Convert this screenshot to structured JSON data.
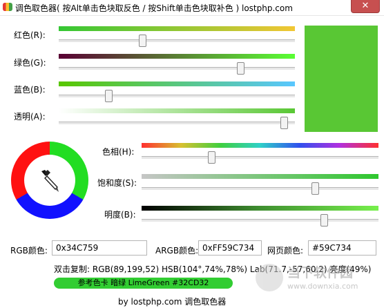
{
  "window": {
    "title": "调色取色器( 按Alt单击色块取反色 / 按Shift单击色块取补色 ) lostphp.com",
    "close_glyph": "✕"
  },
  "rgb_sliders": [
    {
      "label": "红色(R):",
      "value": 89,
      "max": 255,
      "gradient": [
        "#34c734",
        "#f2c734"
      ]
    },
    {
      "label": "绿色(G):",
      "value": 199,
      "max": 255,
      "gradient": [
        "#590034",
        "#59ff34"
      ]
    },
    {
      "label": "蓝色(B):",
      "value": 52,
      "max": 255,
      "gradient": [
        "#59c700",
        "#59c7ff"
      ]
    },
    {
      "label": "透明(A):",
      "value": 247,
      "max": 255,
      "gradient": [
        "#ffffff",
        "#59c734"
      ]
    }
  ],
  "hsb_sliders": [
    {
      "label": "色相(H):",
      "value": 104,
      "max": 360
    },
    {
      "label": "饱和度(S):",
      "value": 74,
      "max": 100
    },
    {
      "label": "明度(B):",
      "value": 78,
      "max": 100
    }
  ],
  "color_swatch": "#59c734",
  "wheel_colors": [
    "#ff1111",
    "#22dd22",
    "#1111ff"
  ],
  "dropper_icon": "eyedropper-icon",
  "fields": {
    "rgb_label": "RGB颜色:",
    "rgb_value": "0x34C759",
    "argb_label": "ARGB颜色:",
    "argb_value": "0xFF59C734",
    "web_label": "网页颜色:",
    "web_value": "#59C734"
  },
  "info_line": "双击复制: RGB(89,199,52) HSB(104°,74%,78%) Lab(71.7,-57,60.2) 亮度(49%)",
  "reference": {
    "text": "参考色卡 暗绿 LimeGreen  #32CD32",
    "background": "#32cd32"
  },
  "footer": "by lostphp.com 调色取色器",
  "watermark": {
    "line1": "当下软件园",
    "line2": "www.downxia.com"
  }
}
